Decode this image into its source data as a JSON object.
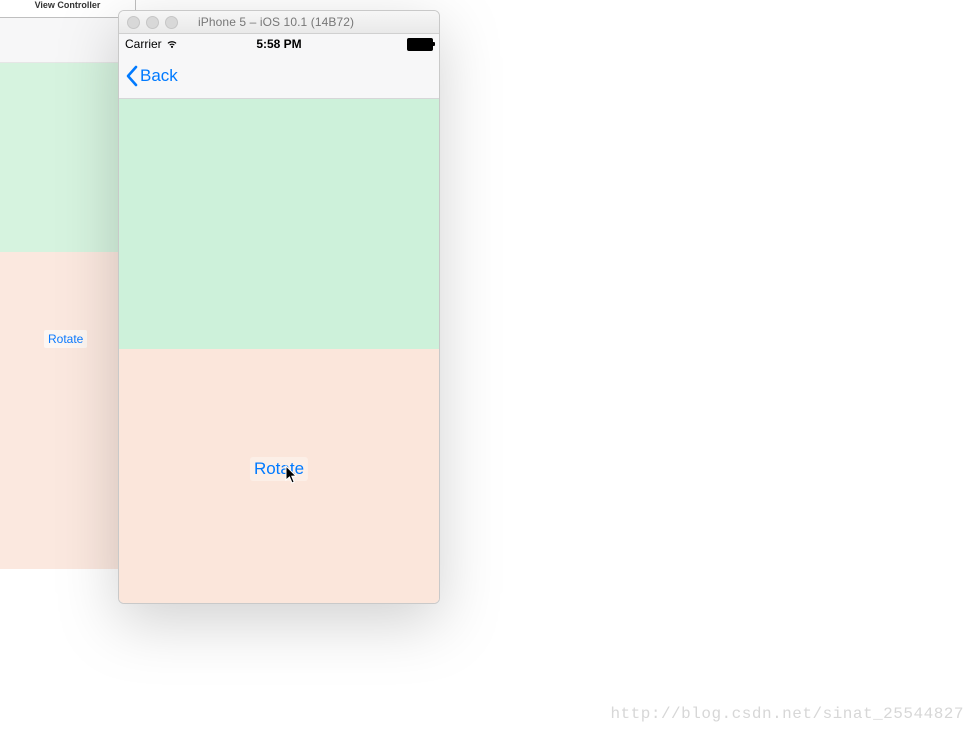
{
  "ib": {
    "title": "View Controller",
    "rotate_label": "Rotate"
  },
  "simulator": {
    "window_title": "iPhone 5 – iOS 10.1 (14B72)"
  },
  "statusbar": {
    "carrier": "Carrier",
    "time": "5:58 PM"
  },
  "navbar": {
    "back_label": "Back"
  },
  "content": {
    "rotate_label": "Rotate"
  },
  "watermark": {
    "text": "http://blog.csdn.net/sinat_25544827"
  }
}
